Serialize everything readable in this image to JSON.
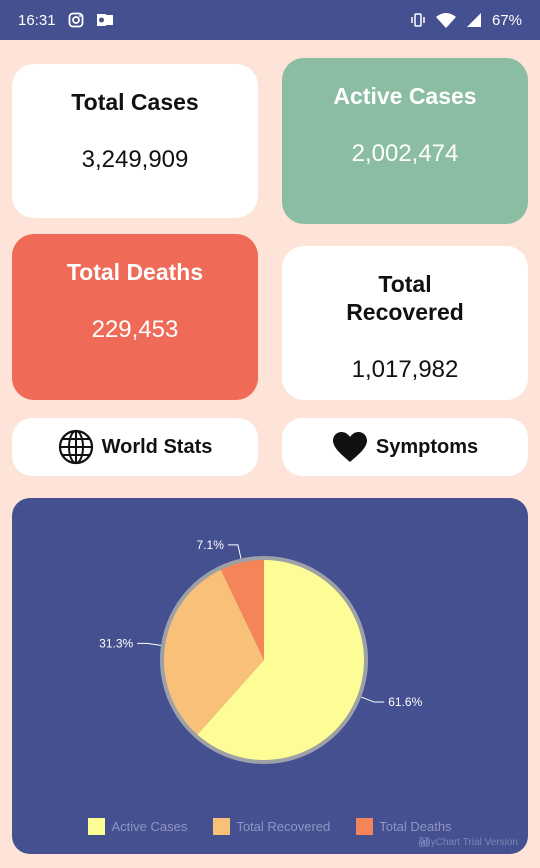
{
  "status_bar": {
    "time": "16:31",
    "battery": "67%",
    "icons": [
      "instagram-icon",
      "outlook-icon",
      "vibrate-icon",
      "wifi-icon",
      "signal-icon"
    ]
  },
  "cards": {
    "total_cases": {
      "title": "Total Cases",
      "value": "3,249,909"
    },
    "active_cases": {
      "title": "Active Cases",
      "value": "2,002,474"
    },
    "total_deaths": {
      "title": "Total Deaths",
      "value": "229,453"
    },
    "total_recovered": {
      "title": "Total Recovered",
      "value": "1,017,982"
    }
  },
  "buttons": {
    "world_stats": {
      "label": "World Stats",
      "icon": "globe-icon"
    },
    "symptoms": {
      "label": "Symptoms",
      "icon": "heart-icon"
    }
  },
  "colors": {
    "background": "#fde3d8",
    "header": "#44508f",
    "active": "#8bbda3",
    "deaths": "#ef6a57",
    "card": "#ffffff"
  },
  "chart_data": {
    "type": "pie",
    "title": "",
    "categories": [
      "Active Cases",
      "Total Recovered",
      "Total Deaths"
    ],
    "values": [
      61.6,
      31.3,
      7.1
    ],
    "labels": [
      "61.6%",
      "31.3%",
      "7.1%"
    ],
    "colors": [
      "#fdfd96",
      "#f9c07a",
      "#f48558"
    ],
    "legend": "bottom",
    "watermark": "AnyChart Trial Version"
  }
}
